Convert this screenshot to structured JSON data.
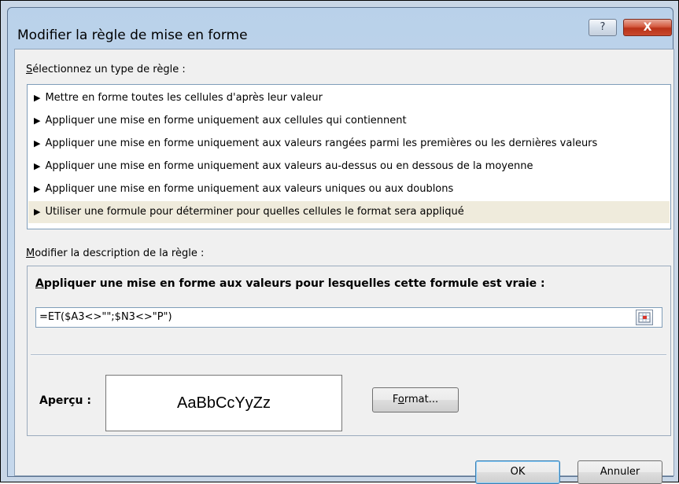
{
  "window": {
    "title": "Modifier la règle de mise en forme",
    "help_label": "?",
    "close_label": "X"
  },
  "rule_type": {
    "label_accel": "S",
    "label_rest": "électionnez un type de règle :",
    "items": [
      {
        "label": "Mettre en forme toutes les cellules d'après leur valeur",
        "selected": false
      },
      {
        "label": "Appliquer une mise en forme uniquement aux cellules qui contiennent",
        "selected": false
      },
      {
        "label": "Appliquer une mise en forme uniquement aux valeurs rangées parmi les premières ou les dernières valeurs",
        "selected": false
      },
      {
        "label": "Appliquer une mise en forme uniquement aux valeurs au-dessus ou en dessous de la moyenne",
        "selected": false
      },
      {
        "label": "Appliquer une mise en forme uniquement aux valeurs uniques ou aux doublons",
        "selected": false
      },
      {
        "label": "Utiliser une formule pour déterminer pour quelles cellules le format sera appliqué",
        "selected": true
      }
    ]
  },
  "description": {
    "label_accel": "M",
    "label_rest": "odifier la description de la règle :",
    "heading_accel": "A",
    "heading_rest": "ppliquer une mise en forme aux valeurs pour lesquelles cette formule est vraie :",
    "formula": "=ET($A3<>\"\";$N3<>\"P\")",
    "preview_label": "Aperçu :",
    "preview_text": "AaBbCcYyZz",
    "format_pre": "F",
    "format_accel": "o",
    "format_post": "rmat..."
  },
  "buttons": {
    "ok": "OK",
    "cancel": "Annuler"
  }
}
